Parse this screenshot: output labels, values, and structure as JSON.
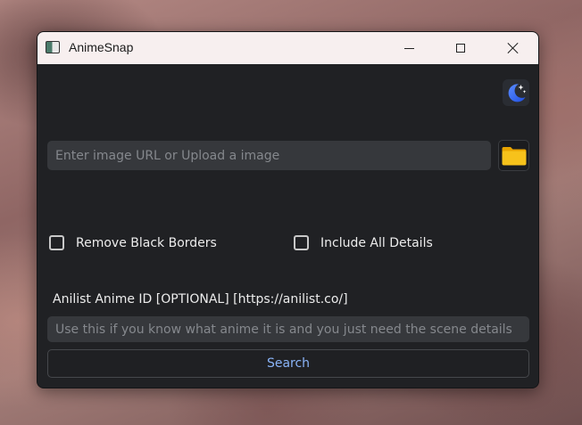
{
  "window": {
    "title": "AnimeSnap"
  },
  "url_input": {
    "placeholder": "Enter image URL or Upload a image",
    "value": ""
  },
  "options": {
    "remove_black_borders": {
      "label": "Remove Black Borders",
      "checked": false
    },
    "include_all_details": {
      "label": "Include All Details",
      "checked": false
    }
  },
  "anilist": {
    "label": "Anilist Anime ID [OPTIONAL] [https://anilist.co/]",
    "placeholder": "Use this if you know what anime it is and you just need the scene details",
    "value": ""
  },
  "search_button": {
    "label": "Search"
  },
  "icons": {
    "app": "app-window-icon",
    "theme": "moon-stars-icon",
    "upload": "folder-icon",
    "minimize": "minimize-icon",
    "maximize": "maximize-icon",
    "close": "close-icon"
  },
  "colors": {
    "window_bg": "#202124",
    "titlebar_bg": "#f7efef",
    "input_bg": "#36383c",
    "search_text": "#8ab4f8",
    "folder_yellow": "#f7c21b",
    "moon_blue": "#2f6bff"
  }
}
